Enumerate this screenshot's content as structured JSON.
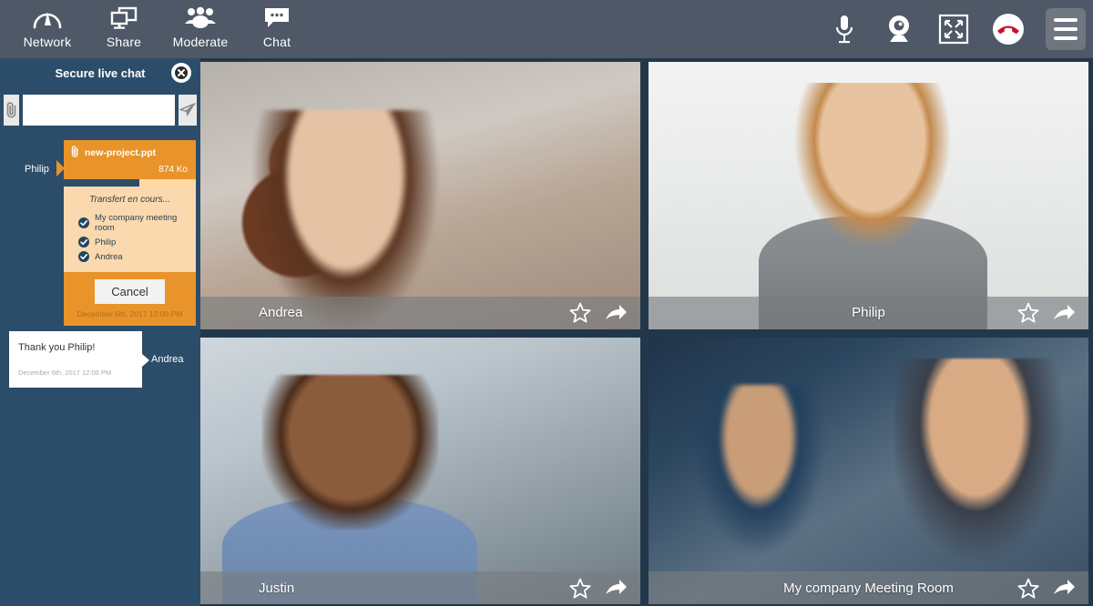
{
  "topbar": {
    "left_items": [
      {
        "label": "Network",
        "icon": "network-gauge-icon"
      },
      {
        "label": "Share",
        "icon": "screen-share-icon"
      },
      {
        "label": "Moderate",
        "icon": "people-group-icon"
      },
      {
        "label": "Chat",
        "icon": "chat-bubble-icon"
      }
    ],
    "right_items": [
      {
        "name": "microphone-icon"
      },
      {
        "name": "webcam-icon"
      },
      {
        "name": "fullscreen-icon"
      },
      {
        "name": "hangup-icon"
      },
      {
        "name": "menu-icon"
      }
    ]
  },
  "sidebar": {
    "title": "Secure live chat",
    "close_label": "×",
    "input": {
      "value": "",
      "placeholder": ""
    },
    "attach_icon": "paperclip-icon",
    "send_icon": "send-plane-icon",
    "file_transfer": {
      "sender": "Philip",
      "file_name": "new-project.ppt",
      "file_size": "874 Ko",
      "progress_percent": 57,
      "status": "Transfert en cours...",
      "recipients": [
        "My company meeting room",
        "Philip",
        "Andrea"
      ],
      "cancel_label": "Cancel",
      "timestamp": "December 6th, 2017 12:00 PM"
    },
    "message": {
      "text": "Thank you Philip!",
      "timestamp": "December 6th, 2017 12:00 PM",
      "sender": "Andrea"
    }
  },
  "grid": {
    "tiles": [
      {
        "name": "Andrea",
        "align": "left",
        "photo": "ph-andrea"
      },
      {
        "name": "Philip",
        "align": "center",
        "photo": "ph-philip"
      },
      {
        "name": "Justin",
        "align": "left",
        "photo": "ph-justin"
      },
      {
        "name": "My company Meeting Room",
        "align": "center",
        "photo": "ph-room"
      }
    ],
    "actions": {
      "favorite": "star-icon",
      "share": "forward-arrow-icon"
    }
  },
  "colors": {
    "topbar": "#4e5866",
    "sidebar": "#2c4d69",
    "accent_orange": "#e8942a",
    "card_body": "#fbd9ae",
    "hangup_red": "#c8102e",
    "grid_bg": "#22374a"
  }
}
